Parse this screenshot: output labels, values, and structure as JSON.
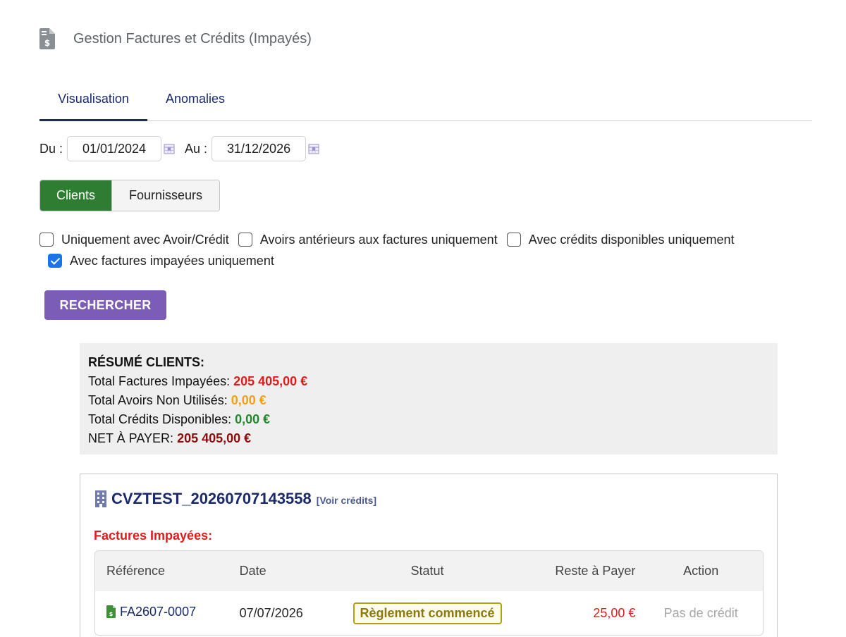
{
  "header": {
    "title": "Gestion Factures et Crédits (Impayés)",
    "icon": "invoice-document-icon"
  },
  "tabs": [
    {
      "label": "Visualisation",
      "active": true
    },
    {
      "label": "Anomalies",
      "active": false
    }
  ],
  "dates": {
    "from_label": "Du :",
    "from_value": "01/01/2024",
    "to_label": "Au :",
    "to_value": "31/12/2026",
    "icon": "calendar-icon"
  },
  "toggle": {
    "clients": "Clients",
    "fournisseurs": "Fournisseurs",
    "active": "clients",
    "active_color": "#2e7d32"
  },
  "filters": [
    {
      "label": "Uniquement avec Avoir/Crédit",
      "checked": false
    },
    {
      "label": "Avoirs antérieurs aux factures uniquement",
      "checked": false
    },
    {
      "label": "Avec crédits disponibles uniquement",
      "checked": false
    },
    {
      "label": "Avec factures impayées uniquement",
      "checked": true
    }
  ],
  "search_button": {
    "label": "RECHERCHER",
    "color": "#7b5db8"
  },
  "summary": {
    "title": "RÉSUMÉ CLIENTS:",
    "impayees_label": "Total Factures Impayées:",
    "impayees_value": "205 405,00 €",
    "avoirs_label": "Total Avoirs Non Utilisés:",
    "avoirs_value": "0,00 €",
    "credits_label": "Total Crédits Disponibles:",
    "credits_value": "0,00 €",
    "net_label": "NET À PAYER:",
    "net_value": "205 405,00 €"
  },
  "client": {
    "name": "CVZTEST_20260707143558",
    "icon": "building-icon",
    "voir_credits": "[Voir crédits]",
    "section_title": "Factures Impayées:",
    "table": {
      "headers": {
        "ref": "Référence",
        "date": "Date",
        "statut": "Statut",
        "reste": "Reste à Payer",
        "action": "Action"
      },
      "rows": [
        {
          "ref": "FA2607-0007",
          "date": "07/07/2026",
          "statut": "Règlement commencé",
          "reste": "25,00 €",
          "action": "Pas de crédit"
        }
      ]
    }
  }
}
